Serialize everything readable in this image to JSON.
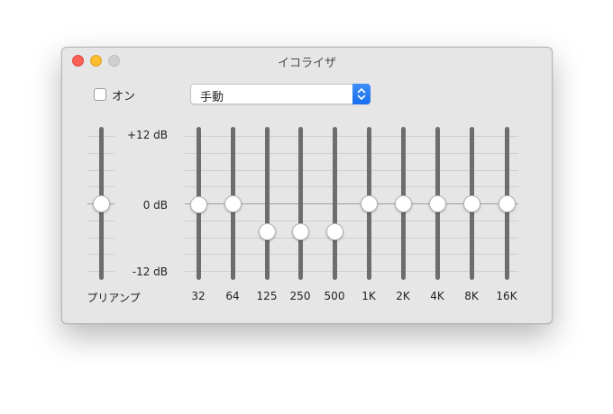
{
  "window": {
    "title": "イコライザ",
    "traffic_colors": {
      "close": "#fc5f57",
      "minimize": "#fdbc2e",
      "zoom": "#cfcfcf"
    }
  },
  "toggle": {
    "label": "オン",
    "checked": false
  },
  "preset": {
    "selected": "手動",
    "accent": "#1a6ff0"
  },
  "scale": {
    "top": "+12 dB",
    "middle": "0 dB",
    "bottom": "-12 dB",
    "max_db": 12,
    "min_db": -12
  },
  "preamp": {
    "label": "プリアンプ",
    "gain_db": 0
  },
  "bands": [
    {
      "label": "32",
      "gain_db": -0.3
    },
    {
      "label": "64",
      "gain_db": 0
    },
    {
      "label": "125",
      "gain_db": -5
    },
    {
      "label": "250",
      "gain_db": -5
    },
    {
      "label": "500",
      "gain_db": -5
    },
    {
      "label": "1K",
      "gain_db": 0
    },
    {
      "label": "2K",
      "gain_db": 0
    },
    {
      "label": "4K",
      "gain_db": 0
    },
    {
      "label": "8K",
      "gain_db": 0
    },
    {
      "label": "16K",
      "gain_db": 0
    }
  ]
}
